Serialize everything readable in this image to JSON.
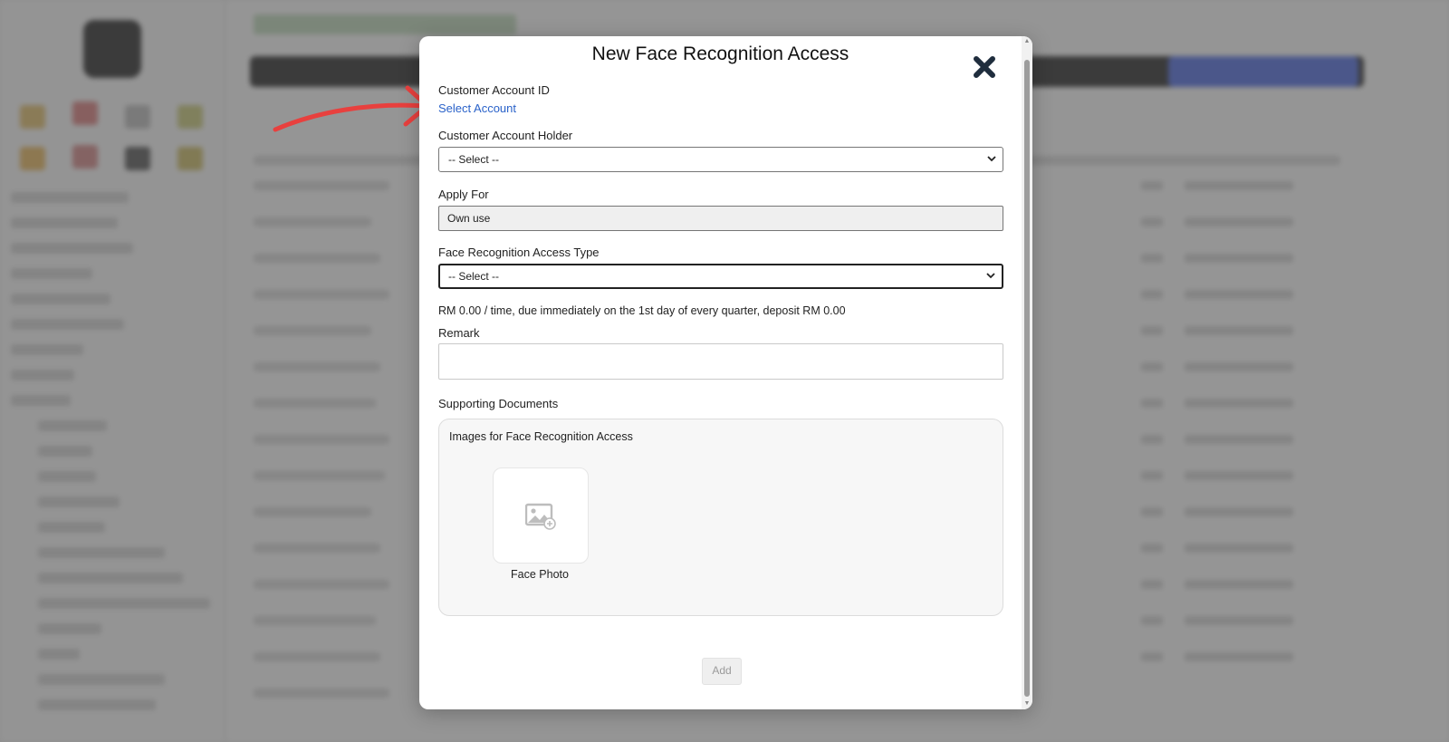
{
  "modal": {
    "title": "New Face Recognition Access",
    "customer_account_id": {
      "label": "Customer Account ID",
      "link": "Select Account"
    },
    "customer_account_holder": {
      "label": "Customer Account Holder",
      "selected": "-- Select --"
    },
    "apply_for": {
      "label": "Apply For",
      "value": "Own use"
    },
    "access_type": {
      "label": "Face Recognition Access Type",
      "selected": "-- Select --"
    },
    "pricing_note": "RM 0.00 / time, due immediately on the 1st day of every quarter, deposit RM 0.00",
    "remark": {
      "label": "Remark",
      "value": ""
    },
    "supporting_documents": {
      "label": "Supporting Documents",
      "box_title": "Images for Face Recognition Access",
      "photo_caption": "Face Photo"
    },
    "add_button": "Add"
  },
  "colors": {
    "link": "#2a62c9",
    "annotation_arrow": "#e8403e",
    "overlay": "rgba(85,85,85,0.62)"
  },
  "icons": {
    "close": "close-icon",
    "photo": "image-add-icon",
    "dropdown": "chevron-down-icon"
  }
}
